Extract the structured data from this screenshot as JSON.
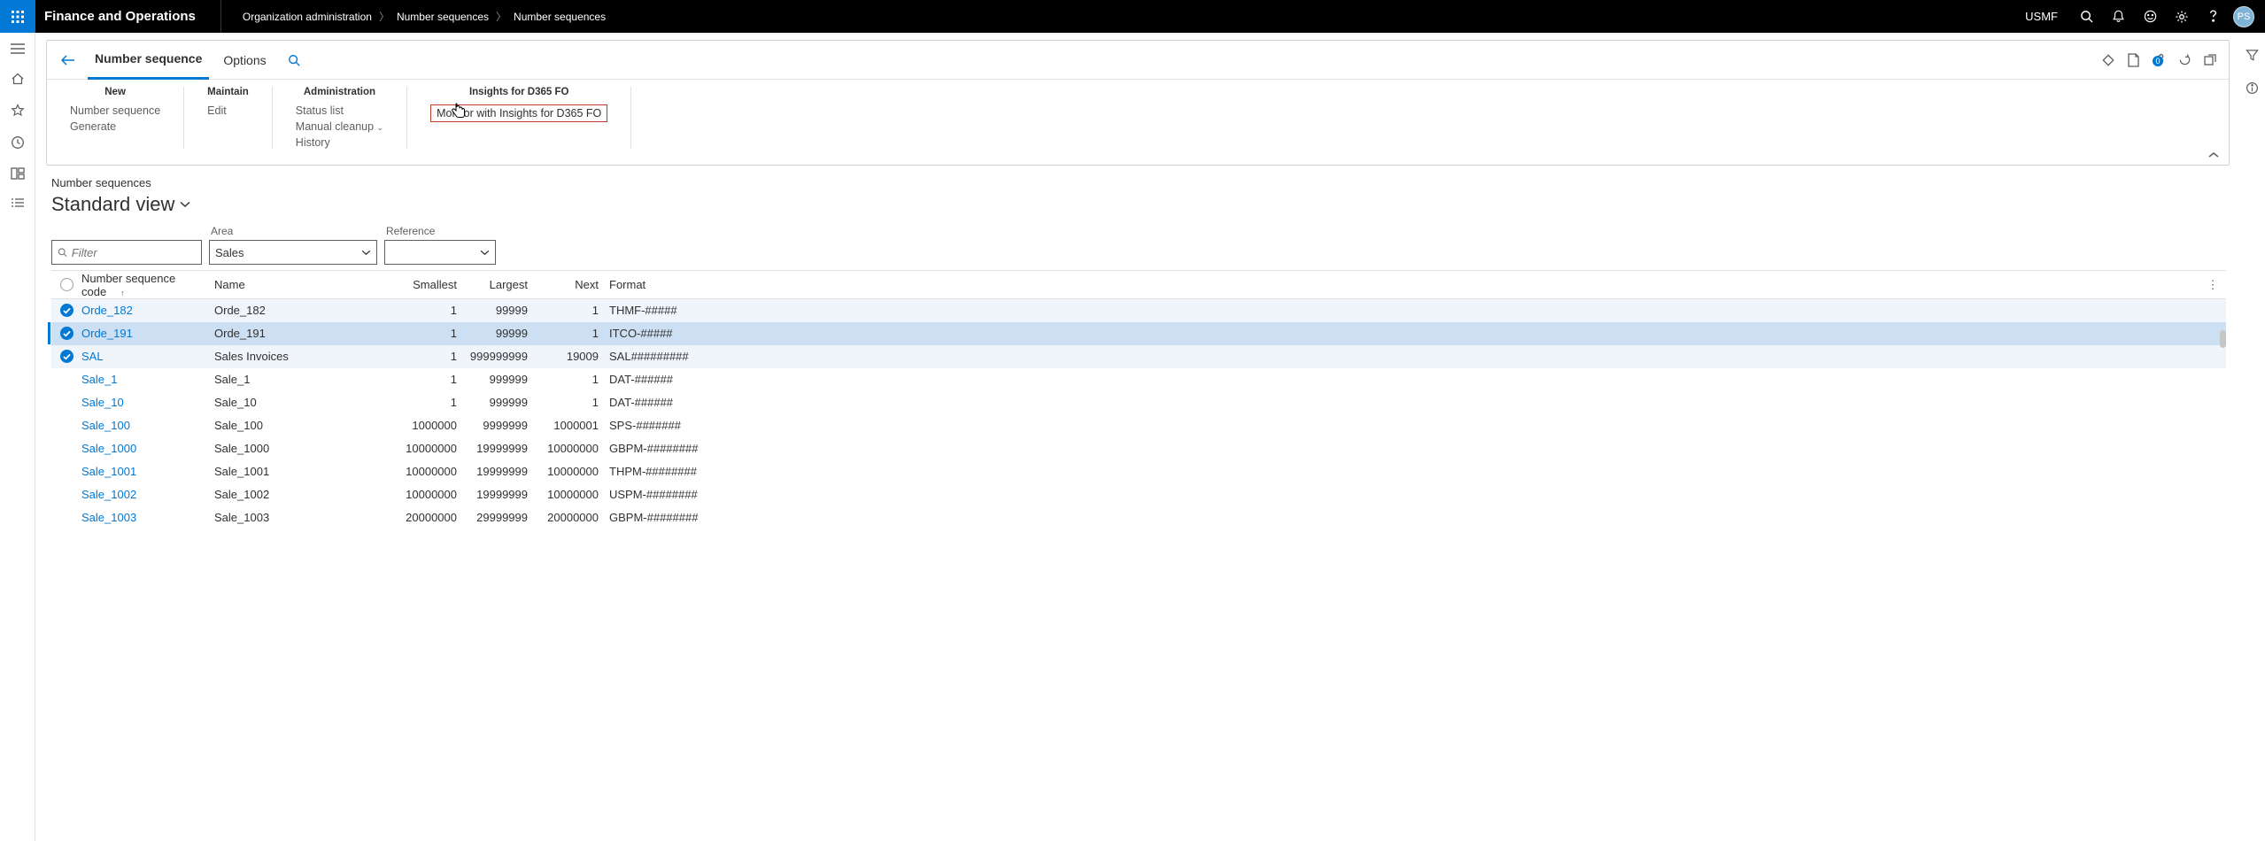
{
  "topbar": {
    "app_title": "Finance and Operations",
    "breadcrumbs": [
      "Organization administration",
      "Number sequences",
      "Number sequences"
    ],
    "company": "USMF",
    "avatar_initials": "PS",
    "attach_badge": "0"
  },
  "ribbon": {
    "tabs": {
      "main": "Number sequence",
      "options": "Options"
    },
    "groups": {
      "new": {
        "title": "New",
        "items": [
          "Number sequence",
          "Generate"
        ]
      },
      "maintain": {
        "title": "Maintain",
        "items": [
          "Edit"
        ]
      },
      "administration": {
        "title": "Administration",
        "items": [
          "Status list",
          "Manual cleanup",
          "History"
        ]
      },
      "insights": {
        "title": "Insights for D365 FO",
        "items": [
          "Monitor with Insights for D365 FO"
        ]
      }
    }
  },
  "content": {
    "crumb": "Number sequences",
    "view_title": "Standard view",
    "filter_placeholder": "Filter",
    "area_label": "Area",
    "area_value": "Sales",
    "reference_label": "Reference",
    "reference_value": ""
  },
  "grid": {
    "headers": {
      "code": "Number sequence code",
      "name": "Name",
      "smallest": "Smallest",
      "largest": "Largest",
      "next": "Next",
      "format": "Format"
    },
    "rows": [
      {
        "sel": true,
        "rc": "softblue",
        "code": "Orde_182",
        "name": "Orde_182",
        "smallest": "1",
        "largest": "99999",
        "next": "1",
        "format": "THMF-#####"
      },
      {
        "sel": true,
        "rc": "active",
        "code": "Orde_191",
        "name": "Orde_191",
        "smallest": "1",
        "largest": "99999",
        "next": "1",
        "format": "ITCO-#####"
      },
      {
        "sel": true,
        "rc": "softblue",
        "code": "SAL",
        "name": "Sales Invoices",
        "smallest": "1",
        "largest": "999999999",
        "next": "19009",
        "format": "SAL#########"
      },
      {
        "sel": false,
        "rc": "",
        "code": "Sale_1",
        "name": "Sale_1",
        "smallest": "1",
        "largest": "999999",
        "next": "1",
        "format": "DAT-######"
      },
      {
        "sel": false,
        "rc": "",
        "code": "Sale_10",
        "name": "Sale_10",
        "smallest": "1",
        "largest": "999999",
        "next": "1",
        "format": "DAT-######"
      },
      {
        "sel": false,
        "rc": "",
        "code": "Sale_100",
        "name": "Sale_100",
        "smallest": "1000000",
        "largest": "9999999",
        "next": "1000001",
        "format": "SPS-#######"
      },
      {
        "sel": false,
        "rc": "",
        "code": "Sale_1000",
        "name": "Sale_1000",
        "smallest": "10000000",
        "largest": "19999999",
        "next": "10000000",
        "format": "GBPM-########"
      },
      {
        "sel": false,
        "rc": "",
        "code": "Sale_1001",
        "name": "Sale_1001",
        "smallest": "10000000",
        "largest": "19999999",
        "next": "10000000",
        "format": "THPM-########"
      },
      {
        "sel": false,
        "rc": "",
        "code": "Sale_1002",
        "name": "Sale_1002",
        "smallest": "10000000",
        "largest": "19999999",
        "next": "10000000",
        "format": "USPM-########"
      },
      {
        "sel": false,
        "rc": "",
        "code": "Sale_1003",
        "name": "Sale_1003",
        "smallest": "20000000",
        "largest": "29999999",
        "next": "20000000",
        "format": "GBPM-########"
      }
    ]
  }
}
